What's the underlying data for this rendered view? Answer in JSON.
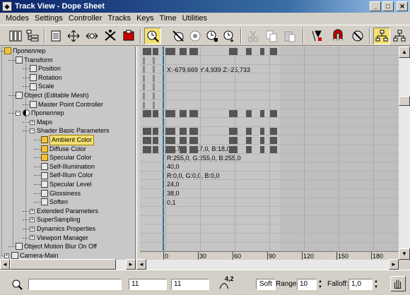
{
  "window": {
    "title": "Track View - Dope Sheet",
    "minimize": "_",
    "maximize": "□",
    "close": "✕"
  },
  "menu": [
    "Modes",
    "Settings",
    "Controller",
    "Tracks",
    "Keys",
    "Time",
    "Utilities"
  ],
  "toolbar": {
    "icons": [
      "filter-icon",
      "hierarchy-icon",
      "edit-keys-icon",
      "move-keys-icon",
      "slide-keys-icon",
      "scale-keys-icon",
      "scale-time-icon",
      "insert-time-icon",
      "select-time-icon",
      "delete-time-icon",
      "reverse-time-icon",
      "exclude-range-icon",
      "copy-icon",
      "paste-icon",
      "cut-icon",
      "lock-icon",
      "snap-icon",
      "modify-subtree-icon",
      "show-keyable-icon",
      "zoom-hand-icon"
    ]
  },
  "tree": {
    "items": [
      {
        "label": "Пропеллер",
        "indent": 0,
        "icon": "object-icon",
        "expander": ""
      },
      {
        "label": "Transform",
        "indent": 1,
        "icon": "transform-icon",
        "expander": ""
      },
      {
        "label": "Position",
        "indent": 2,
        "icon": "position-icon",
        "expander": ""
      },
      {
        "label": "Rotation",
        "indent": 2,
        "icon": "rotation-icon",
        "expander": ""
      },
      {
        "label": "Scale",
        "indent": 2,
        "icon": "scale-icon",
        "expander": ""
      },
      {
        "label": "Object (Editable Mesh)",
        "indent": 1,
        "icon": "mesh-icon",
        "expander": ""
      },
      {
        "label": "Master Point Controller",
        "indent": 2,
        "icon": "controller-icon",
        "expander": ""
      },
      {
        "label": "Пропеллер",
        "indent": 1,
        "icon": "material-icon",
        "expander": "−"
      },
      {
        "label": "Maps",
        "indent": 2,
        "icon": "",
        "expander": "+"
      },
      {
        "label": "Shader Basic Parameters",
        "indent": 2,
        "icon": "",
        "expander": "−"
      },
      {
        "label": "Ambient Color",
        "indent": 3,
        "icon": "color-icon",
        "expander": "",
        "selected": true
      },
      {
        "label": "Diffuse Color",
        "indent": 3,
        "icon": "color-icon",
        "expander": ""
      },
      {
        "label": "Specular Color",
        "indent": 3,
        "icon": "color-icon",
        "expander": ""
      },
      {
        "label": "Self-Illumination",
        "indent": 3,
        "icon": "track-icon",
        "expander": ""
      },
      {
        "label": "Self-Illum Color",
        "indent": 3,
        "icon": "track-icon",
        "expander": ""
      },
      {
        "label": "Specular Level",
        "indent": 3,
        "icon": "track-icon",
        "expander": ""
      },
      {
        "label": "Glossiness",
        "indent": 3,
        "icon": "track-icon",
        "expander": ""
      },
      {
        "label": "Soften",
        "indent": 3,
        "icon": "track-icon",
        "expander": ""
      },
      {
        "label": "Extended Parameters",
        "indent": 2,
        "icon": "",
        "expander": "+"
      },
      {
        "label": "SuperSampling",
        "indent": 2,
        "icon": "",
        "expander": "+"
      },
      {
        "label": "Dynamics Properties",
        "indent": 2,
        "icon": "",
        "expander": "+"
      },
      {
        "label": "Viewport Manager",
        "indent": 2,
        "icon": "",
        "expander": "+"
      },
      {
        "label": "Object Motion Blur On Off",
        "indent": 1,
        "icon": "controller-icon",
        "expander": ""
      },
      {
        "label": "Camera-Main",
        "indent": 0,
        "icon": "camera-icon",
        "expander": "+"
      }
    ]
  },
  "dope": {
    "cursor_readout": "X:-679,669 Y:4,939 Z:-25,733",
    "values": [
      "R:17,0, G:17,0, B:18,0",
      "R:255,0, G:255,0, B:255,0",
      "40,0",
      "R:0,0, G:0,0, B:0,0",
      "24,0",
      "38,0",
      "0,1"
    ]
  },
  "ruler": {
    "ticks": [
      "0",
      "30",
      "60",
      "90",
      "120",
      "150",
      "180"
    ]
  },
  "status": {
    "field1": "",
    "current_frame": "11",
    "end_frame": "11",
    "zoom_value": "4,2",
    "soft_label": "Soft",
    "range_label": "Range:",
    "range_value": "10",
    "falloff_label": "Falloff:",
    "falloff_value": "1,0"
  }
}
